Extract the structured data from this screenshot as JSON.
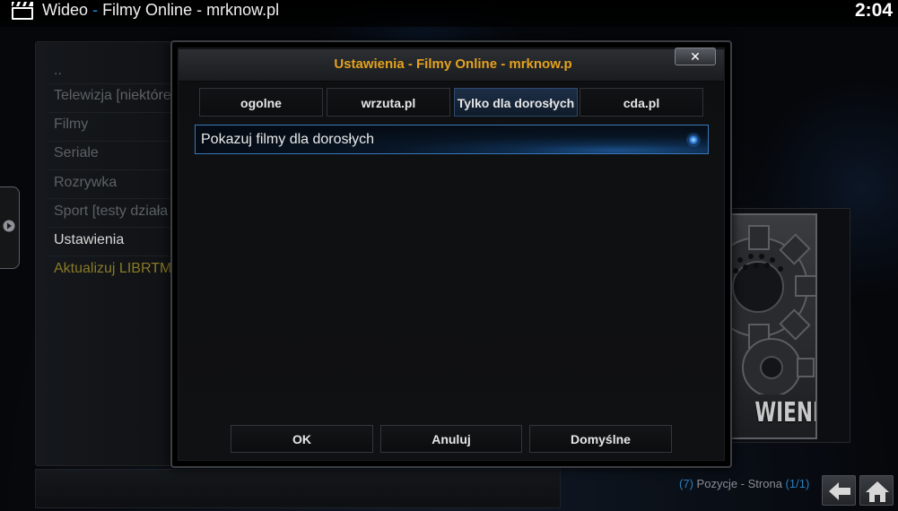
{
  "header": {
    "app": "Wideo",
    "separator": "-",
    "section": "Filmy Online - mrknow.pl",
    "clock": "2:04"
  },
  "sidebar": {
    "items": [
      {
        "label": ".."
      },
      {
        "label": "Telewizja [niektóre"
      },
      {
        "label": "Filmy"
      },
      {
        "label": "Seriale"
      },
      {
        "label": "Rozrywka"
      },
      {
        "label": "Sport [testy działa"
      },
      {
        "label": "Ustawienia"
      },
      {
        "label": "Aktualizuj LIBRTM"
      }
    ]
  },
  "thumbnail": {
    "label": "WIENIA"
  },
  "dialog": {
    "title": "Ustawienia - Filmy Online - mrknow.p",
    "close_symbol": "✕",
    "tabs": [
      {
        "label": "ogolne"
      },
      {
        "label": "wrzuta.pl"
      },
      {
        "label": "Tylko dla dorosłych"
      },
      {
        "label": "cda.pl"
      }
    ],
    "active_tab": "Tylko dla dorosłych",
    "setting": {
      "label": "Pokazuj filmy dla dorosłych",
      "enabled": true
    },
    "buttons": {
      "ok": "OK",
      "cancel": "Anuluj",
      "defaults": "Domyślne"
    }
  },
  "footer": {
    "paren_open": "(",
    "count": "7",
    "paren_close": ")",
    "positions_text": "Pozycje - Strona",
    "page_open": "(",
    "page": "1/1",
    "page_close": ")"
  },
  "colors": {
    "accent": "#e4a21e",
    "highlight": "#3b78b8",
    "link": "#2a7fc0"
  }
}
